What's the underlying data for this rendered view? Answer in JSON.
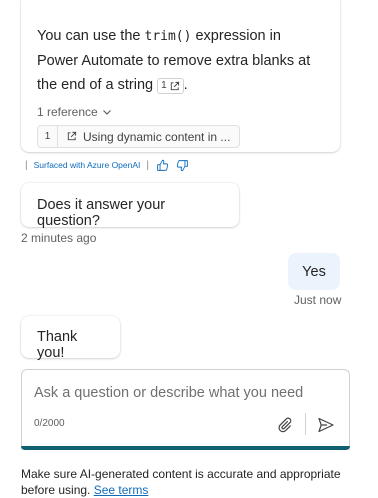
{
  "messages": {
    "answer": {
      "text_before": "You can use the ",
      "code": "trim()",
      "text_after": " expression in Power Automate to remove extra blanks at the end of a string ",
      "citation_number": "1",
      "period": "."
    },
    "references": {
      "toggle_label": "1 reference",
      "items": [
        {
          "number": "1",
          "title": "Using dynamic content in ..."
        }
      ]
    },
    "surfaced_label": "Surfaced with Azure OpenAI",
    "question": "Does it answer your question?",
    "question_timestamp": "2 minutes ago",
    "user_reply": "Yes",
    "user_timestamp": "Just now",
    "bot_reply": "Thank you!"
  },
  "composer": {
    "placeholder": "Ask a question or describe what you need",
    "counter": "0/2000"
  },
  "disclaimer": {
    "text": "Make sure AI-generated content is accurate and appropriate before using. ",
    "link": "See terms"
  },
  "icons": {
    "thumbs_up": "thumbs-up-icon",
    "thumbs_down": "thumbs-down-icon",
    "attach": "paperclip-icon",
    "send": "send-icon",
    "external_link": "open-external-icon",
    "chevron": "chevron-down-icon"
  },
  "colors": {
    "link": "#0f6cbd",
    "user_bubble": "#ebf3fc",
    "composer_accent": "#0f6172"
  }
}
